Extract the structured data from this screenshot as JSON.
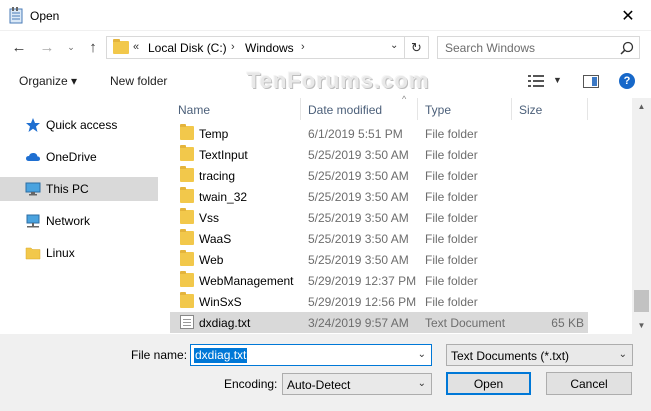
{
  "window": {
    "title": "Open"
  },
  "address": {
    "overflow": "«",
    "parts": [
      "Local Disk (C:)",
      "Windows"
    ]
  },
  "search": {
    "placeholder": "Search Windows"
  },
  "toolbar": {
    "organize": "Organize ▾",
    "new_folder": "New folder",
    "help": "?"
  },
  "watermark": "TenForums.com",
  "sidebar": {
    "items": [
      {
        "label": "Quick access",
        "icon": "star-icon"
      },
      {
        "label": "OneDrive",
        "icon": "cloud-icon"
      },
      {
        "label": "This PC",
        "icon": "computer-icon"
      },
      {
        "label": "Network",
        "icon": "network-icon"
      },
      {
        "label": "Linux",
        "icon": "folder-icon"
      }
    ]
  },
  "columns": {
    "name": "Name",
    "date": "Date modified",
    "type": "Type",
    "size": "Size"
  },
  "files": [
    {
      "name": "Temp",
      "date": "6/1/2019 5:51 PM",
      "type": "File folder",
      "size": ""
    },
    {
      "name": "TextInput",
      "date": "5/25/2019 3:50 AM",
      "type": "File folder",
      "size": ""
    },
    {
      "name": "tracing",
      "date": "5/25/2019 3:50 AM",
      "type": "File folder",
      "size": ""
    },
    {
      "name": "twain_32",
      "date": "5/25/2019 3:50 AM",
      "type": "File folder",
      "size": ""
    },
    {
      "name": "Vss",
      "date": "5/25/2019 3:50 AM",
      "type": "File folder",
      "size": ""
    },
    {
      "name": "WaaS",
      "date": "5/25/2019 3:50 AM",
      "type": "File folder",
      "size": ""
    },
    {
      "name": "Web",
      "date": "5/25/2019 3:50 AM",
      "type": "File folder",
      "size": ""
    },
    {
      "name": "WebManagement",
      "date": "5/29/2019 12:37 PM",
      "type": "File folder",
      "size": ""
    },
    {
      "name": "WinSxS",
      "date": "5/29/2019 12:56 PM",
      "type": "File folder",
      "size": ""
    },
    {
      "name": "dxdiag.txt",
      "date": "3/24/2019 9:57 AM",
      "type": "Text Document",
      "size": "65 KB"
    }
  ],
  "bottom": {
    "filename_label": "File name:",
    "filename_value": "dxdiag.txt",
    "filetype_value": "Text Documents (*.txt)",
    "encoding_label": "Encoding:",
    "encoding_value": "Auto-Detect",
    "open_label": "Open",
    "cancel_label": "Cancel"
  }
}
